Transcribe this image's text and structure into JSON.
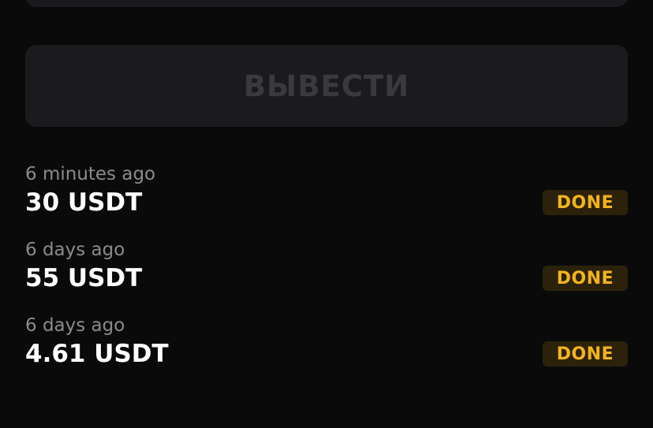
{
  "withdraw_button": {
    "label": "ВЫВЕСТИ",
    "enabled": false
  },
  "transactions": [
    {
      "time": "6 minutes ago",
      "amount": "30 USDT",
      "status": "DONE"
    },
    {
      "time": "6 days ago",
      "amount": "55 USDT",
      "status": "DONE"
    },
    {
      "time": "6 days ago",
      "amount": "4.61 USDT",
      "status": "DONE"
    }
  ],
  "colors": {
    "background": "#0a0a0b",
    "card": "#1b1b1d",
    "disabled_text": "#3a3a3d",
    "muted_text": "#8b8b8e",
    "status_bg": "#2c220b",
    "status_text": "#f4b41a"
  }
}
